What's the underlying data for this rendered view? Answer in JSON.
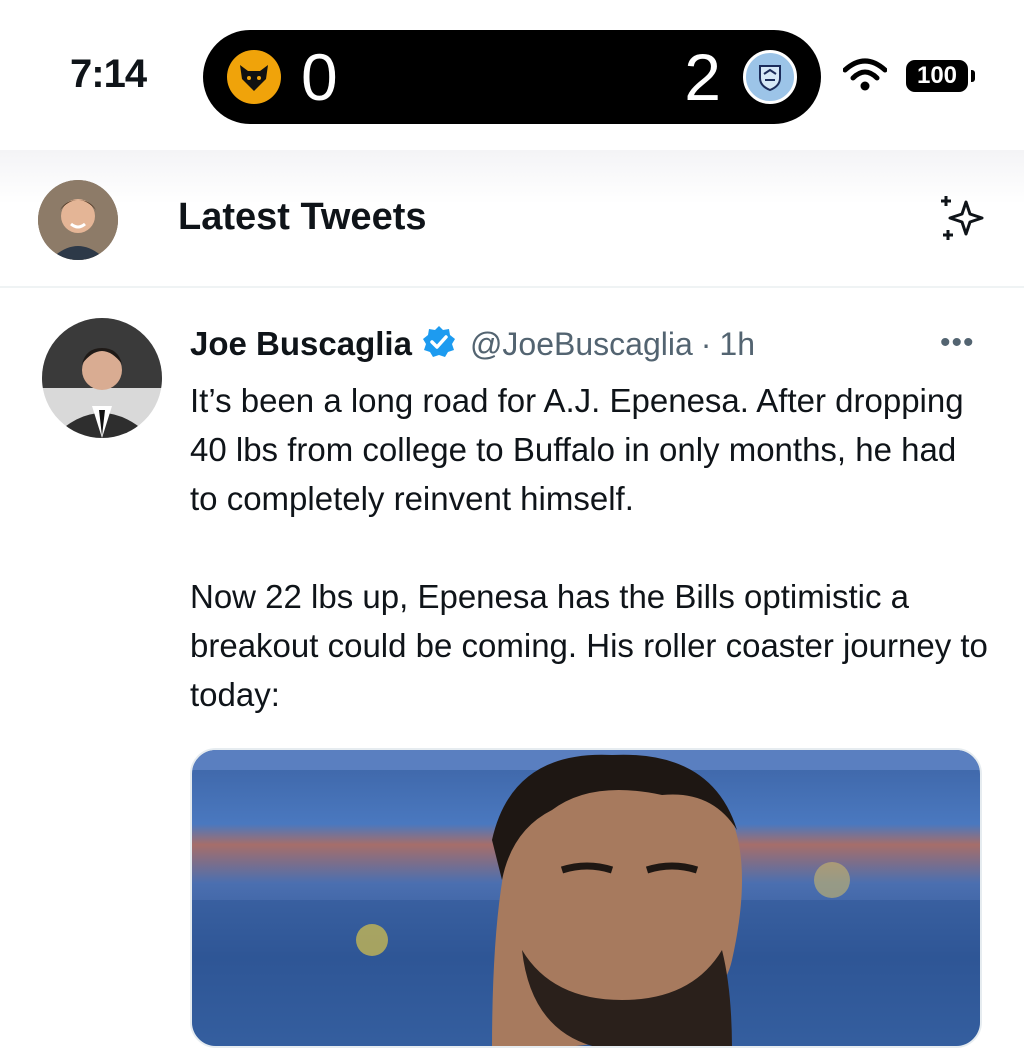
{
  "status_bar": {
    "time": "7:14",
    "battery": "100",
    "icons": [
      "wifi-icon",
      "battery-icon"
    ]
  },
  "live_activity": {
    "home_team_badge": "wolves-badge-icon",
    "home_score": "0",
    "away_score": "2",
    "away_team_badge": "manchester-city-badge-icon"
  },
  "header": {
    "title": "Latest Tweets",
    "right_icon": "sparkle-icon"
  },
  "tweet": {
    "author_name": "Joe Buscaglia",
    "verified_icon": "verified-badge-icon",
    "handle": "@JoeBuscaglia",
    "separator": "·",
    "time": "1h",
    "more_label": "•••",
    "paragraph_1": "It’s been a long road for A.J. Epenesa. After dropping 40 lbs from college to Buffalo in only months, he had to completely reinvent himself.",
    "paragraph_2": "Now 22 lbs up, Epenesa has the Bills optimistic a breakout could be coming. His roller coaster journey to today:"
  },
  "colors": {
    "text": "#0f1419",
    "secondary_text": "#536471",
    "verified": "#1d9bf0",
    "island": "#000000",
    "wolves_gold": "#f0a30a",
    "city_blue": "#9cc4e8"
  }
}
